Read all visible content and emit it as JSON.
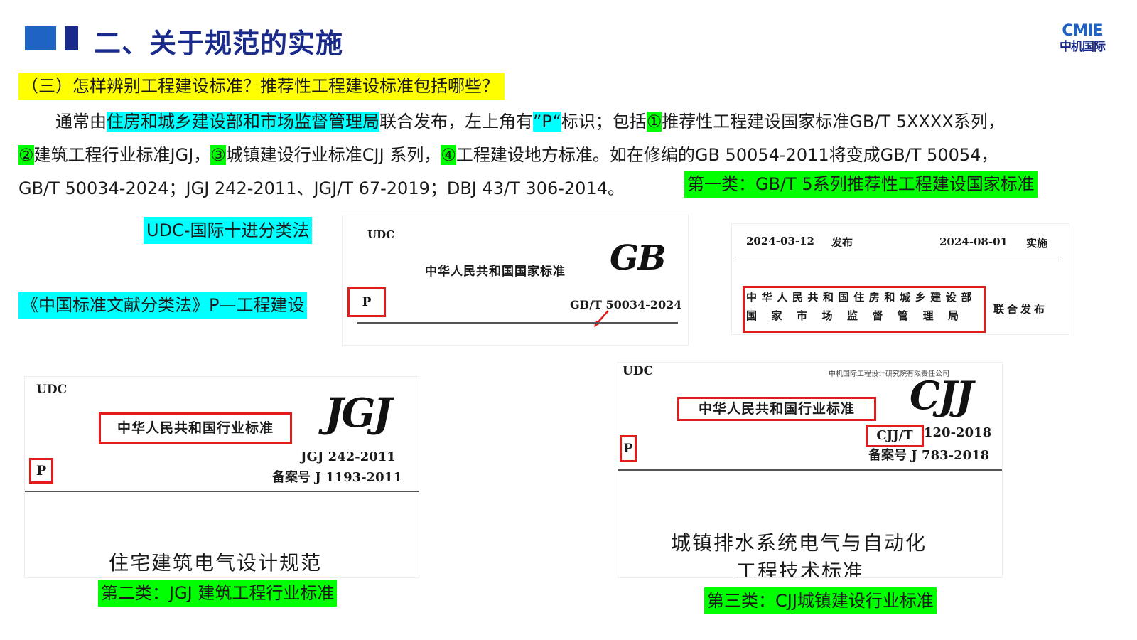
{
  "header": {
    "title": "二、关于规范的实施",
    "logo_top": "CMIE",
    "logo_bottom": "中机国际"
  },
  "question": "（三）怎样辨别工程建设标准？推荐性工程建设标准包括哪些？",
  "paragraph": {
    "p1": "通常由",
    "hl1": "住房和城乡建设部和市场监督管理局",
    "p2": "联合发布，左上角有",
    "hl2": "”P“",
    "p3": "标识；包括",
    "n1": "①",
    "p4": "推荐性工程建设国家标准GB/T 5XXXX系列，",
    "n2": "②",
    "p5": "建筑工程行业标准JGJ，",
    "n3": "③",
    "p6": "城镇建设行业标准CJJ 系列，",
    "n4": "④",
    "p7": "工程建设地方标准。如在修编的GB 50054-2011将变成GB/T 50054，",
    "p8": "GB/T 50034-2024；JGJ 242-2011、JGJ/T 67-2019；DBJ 43/T 306-2014。",
    "class1": "第一类：GB/T 5系列推荐性工程建设国家标准"
  },
  "labels": {
    "udc": "UDC-国际十进分类法",
    "clc": "《中国标准文献分类法》P—工程建设",
    "class2": "第二类：JGJ  建筑工程行业标准",
    "class3": "第三类：CJJ城镇建设行业标准"
  },
  "gb_image": {
    "udc": "UDC",
    "national": "中华人民共和国国家标准",
    "logo": "GB",
    "p": "P",
    "code": "GB/T 50034-2024"
  },
  "publish_image": {
    "date1": "2024-03-12",
    "issue": "发布",
    "date2": "2024-08-01",
    "impl": "实施",
    "org1": "中华人民共和国住房和城乡建设部",
    "org2": "国家市场监督管理局",
    "joint": "联合发布"
  },
  "jgj_image": {
    "udc": "UDC",
    "industry": "中华人民共和国行业标准",
    "logo": "JGJ",
    "p": "P",
    "code": "JGJ 242-2011",
    "record": "备案号 J 1193-2011",
    "name": "住宅建筑电气设计规范"
  },
  "cjj_image": {
    "udc": "UDC",
    "company": "中机国际工程设计研究院有限责任公司",
    "industry": "中华人民共和国行业标准",
    "logo": "CJJ",
    "p": "P",
    "code_prefix": "CJJ/T",
    "code_rest": "120-2018",
    "record": "备案号 J 783-2018",
    "name1": "城镇排水系统电气与自动化",
    "name2": "工程技术标准"
  },
  "colors": {
    "title": "#1a2a8a",
    "accent": "#1f64c4",
    "yellow": "#ffff00",
    "cyan": "#00ffff",
    "green": "#00ff00",
    "red": "#e21c1c"
  }
}
